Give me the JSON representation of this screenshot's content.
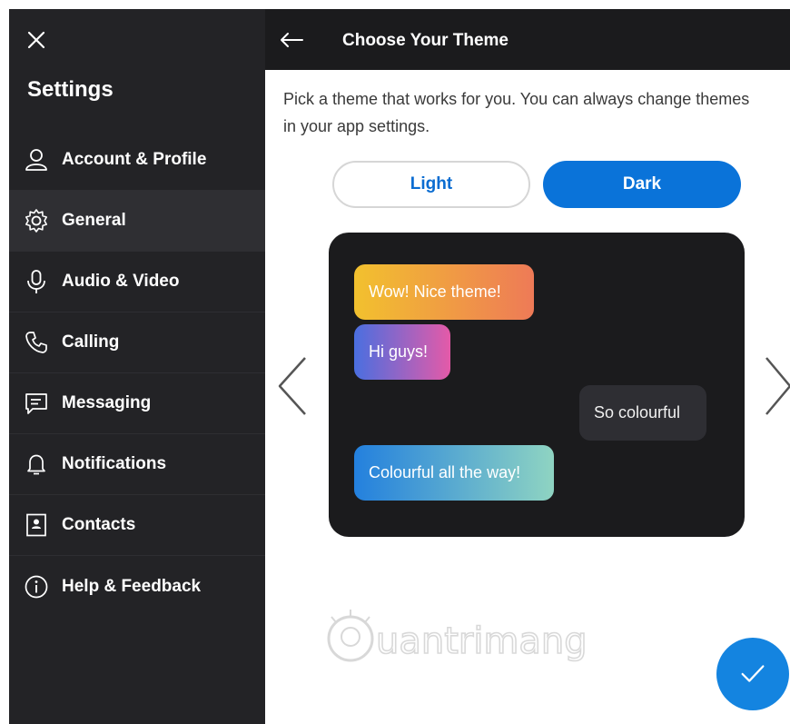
{
  "sidebar": {
    "title": "Settings",
    "items": [
      {
        "label": "Account & Profile",
        "icon": "person-icon"
      },
      {
        "label": "General",
        "icon": "gear-icon"
      },
      {
        "label": "Audio & Video",
        "icon": "microphone-icon"
      },
      {
        "label": "Calling",
        "icon": "phone-icon"
      },
      {
        "label": "Messaging",
        "icon": "message-icon"
      },
      {
        "label": "Notifications",
        "icon": "bell-icon"
      },
      {
        "label": "Contacts",
        "icon": "contact-card-icon"
      },
      {
        "label": "Help & Feedback",
        "icon": "info-icon"
      }
    ],
    "active_index": 1
  },
  "header": {
    "title": "Choose Your Theme"
  },
  "main": {
    "description": "Pick a theme that works for you. You can always change themes in your app settings.",
    "theme_options": {
      "light": "Light",
      "dark": "Dark",
      "selected": "Dark"
    },
    "preview_messages": [
      {
        "text": "Wow! Nice theme!"
      },
      {
        "text": "Hi guys!"
      },
      {
        "text": "So colourful"
      },
      {
        "text": "Colourful all the way!"
      }
    ]
  },
  "watermark": {
    "text": "uantrimang"
  },
  "colors": {
    "sidebar_bg": "#232326",
    "accent": "#0a73d9",
    "confirm_button": "#1484e0"
  }
}
